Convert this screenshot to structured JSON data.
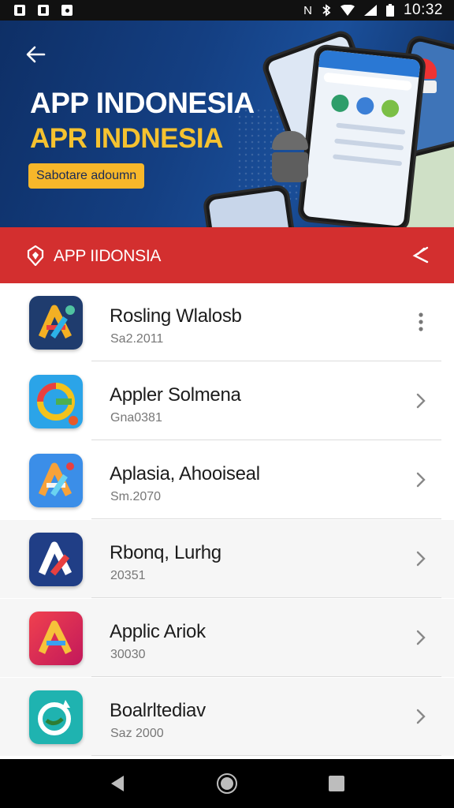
{
  "status_bar": {
    "time": "10:32",
    "left_icons": [
      "notification-n-icon",
      "notification-a-icon",
      "notification-photo-icon"
    ],
    "right_icons": [
      "nfc-icon",
      "bluetooth-icon",
      "wifi-icon",
      "signal-icon",
      "battery-icon"
    ]
  },
  "banner": {
    "title": "APP INDONESIA",
    "subtitle": "APR INDNESIA",
    "cta_label": "Sabotare adoumn",
    "back_icon": "arrow-left-icon"
  },
  "appbar": {
    "title": "APP IIDONSIA",
    "logo_icon": "shield-logo-icon",
    "share_icon": "share-icon",
    "color": "#d32f2f"
  },
  "apps": [
    {
      "name": "Rosling Wlalosb",
      "meta": "Sa2.2011",
      "action": "more-vert-icon"
    },
    {
      "name": "Appler Solmena",
      "meta": "Gna0381",
      "action": "chevron-right-icon"
    },
    {
      "name": "Aplasia, Ahooiseal",
      "meta": "Sm.2070",
      "action": "chevron-right-icon"
    },
    {
      "name": "Rbonq, Lurhg",
      "meta": "20351",
      "action": "chevron-right-icon"
    },
    {
      "name": "Applic Ariok",
      "meta": "30030",
      "action": "chevron-right-icon"
    },
    {
      "name": "Boalrltediav",
      "meta": "Saz 2000",
      "action": "chevron-right-icon"
    }
  ],
  "nav_bar": {
    "back_icon": "nav-back-icon",
    "home_icon": "nav-home-icon",
    "recents_icon": "nav-recents-icon"
  }
}
